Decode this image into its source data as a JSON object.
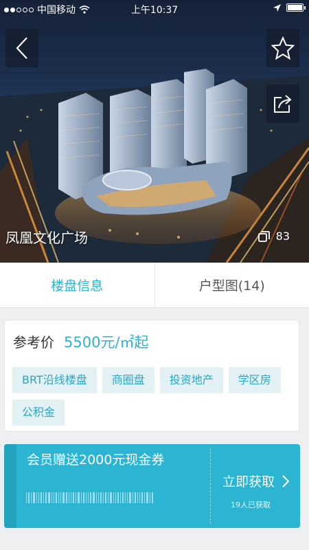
{
  "status_bar": {
    "carrier": "中国移动",
    "time": "上午10:37"
  },
  "hero": {
    "title": "凤凰文化广场",
    "photo_count": "83"
  },
  "tabs": [
    {
      "label": "楼盘信息",
      "active": true
    },
    {
      "label": "户型图(14)",
      "active": false
    }
  ],
  "price": {
    "label": "参考价",
    "value": "5500元/㎡起"
  },
  "tags": [
    "BRT沿线楼盘",
    "商圈盘",
    "投资地产",
    "学区房",
    "公积金"
  ],
  "coupon": {
    "title": "会员赠送2000元现金券",
    "cta": "立即获取",
    "claimed": "19人已获取"
  },
  "colors": {
    "accent": "#29b3cf",
    "tag_bg": "#e3f1f5",
    "coupon_bg": "#2bb5d3"
  },
  "icons": {
    "back": "chevron-left-icon",
    "favorite": "star-outline-icon",
    "share": "share-icon",
    "photos": "gallery-icon",
    "cta": "chevron-right-icon"
  }
}
